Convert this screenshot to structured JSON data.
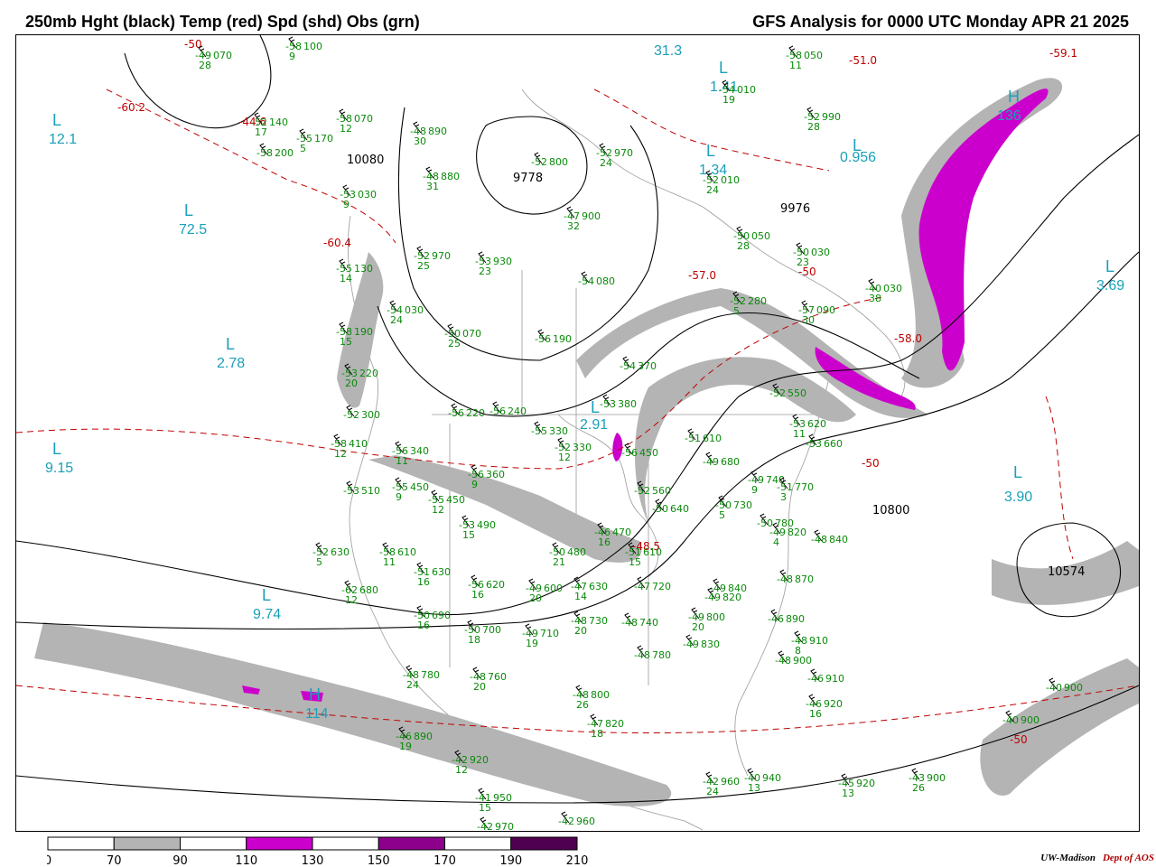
{
  "header": {
    "left_title": "250mb Hght (black) Temp (red) Spd (shd) Obs (grn)",
    "right_title": "GFS Analysis for 0000 UTC Monday  APR 21 2025"
  },
  "colors": {
    "height_contour": "#000000",
    "temperature_contour": "#c00000",
    "observations": "#0a8a0a",
    "extrema_labels": "#1aa0b8",
    "speed_70_90": "#b4b4b4",
    "speed_110_130": "#cc00cc",
    "speed_150_170": "#8c008c",
    "speed_190_210": "#500050"
  },
  "legend": {
    "ticks": [
      "0",
      "70",
      "90",
      "110",
      "130",
      "150",
      "170",
      "190",
      "210"
    ],
    "segments": [
      {
        "fill": "#ffffff"
      },
      {
        "fill": "#b4b4b4"
      },
      {
        "fill": "#ffffff"
      },
      {
        "fill": "#cc00cc"
      },
      {
        "fill": "#ffffff"
      },
      {
        "fill": "#8c008c"
      },
      {
        "fill": "#ffffff"
      },
      {
        "fill": "#500050"
      }
    ]
  },
  "extrema": [
    {
      "sym": "L",
      "value": "12.1"
    },
    {
      "sym": "L",
      "value": "72.5"
    },
    {
      "sym": "L",
      "value": "2.78"
    },
    {
      "sym": "L",
      "value": "9.15"
    },
    {
      "sym": "L",
      "value": "9.74"
    },
    {
      "sym": "L",
      "value": "31.3"
    },
    {
      "sym": "L",
      "value": "1.41"
    },
    {
      "sym": "L",
      "value": "1.34"
    },
    {
      "sym": "L",
      "value": "0.956"
    },
    {
      "sym": "L",
      "value": "3.69"
    },
    {
      "sym": "L",
      "value": "3.90"
    },
    {
      "sym": "L",
      "value": "2.91"
    },
    {
      "sym": "H",
      "value": "114"
    },
    {
      "sym": "H",
      "value": "136"
    }
  ],
  "height_labels": [
    "10080",
    "9778",
    "9976",
    "10800",
    "10574"
  ],
  "temperature_labels": [
    "-50",
    "-60.2",
    "-44.6",
    "-60.4",
    "-57.0",
    "-59.1",
    "-51.0",
    "-58.0",
    "-48.5",
    "-50",
    "-50",
    "-50"
  ],
  "observations": [
    {
      "t": "-49",
      "h": "070",
      "s": "28"
    },
    {
      "t": "-58",
      "h": "100",
      "s": "9"
    },
    {
      "t": "-52",
      "h": "140",
      "s": "17"
    },
    {
      "t": "-55",
      "h": "170",
      "s": "5"
    },
    {
      "t": "-58",
      "h": "200",
      "s": ""
    },
    {
      "t": "-58",
      "h": "070",
      "s": "12"
    },
    {
      "t": "-48",
      "h": "890",
      "s": "30"
    },
    {
      "t": "-48",
      "h": "880",
      "s": "31"
    },
    {
      "t": "-52",
      "h": "800",
      "s": ""
    },
    {
      "t": "-52",
      "h": "970",
      "s": "24"
    },
    {
      "t": "-54",
      "h": "010",
      "s": "19"
    },
    {
      "t": "-58",
      "h": "050",
      "s": "11"
    },
    {
      "t": "-52",
      "h": "990",
      "s": "28"
    },
    {
      "t": "-52",
      "h": "010",
      "s": "24"
    },
    {
      "t": "-47",
      "h": "900",
      "s": "32"
    },
    {
      "t": "-53",
      "h": "030",
      "s": "9"
    },
    {
      "t": "-52",
      "h": "970",
      "s": "25"
    },
    {
      "t": "-53",
      "h": "930",
      "s": "23"
    },
    {
      "t": "-55",
      "h": "130",
      "s": "14"
    },
    {
      "t": "-54",
      "h": "030",
      "s": "24"
    },
    {
      "t": "-50",
      "h": "070",
      "s": "25"
    },
    {
      "t": "-54",
      "h": "080",
      "s": ""
    },
    {
      "t": "-50",
      "h": "050",
      "s": "28"
    },
    {
      "t": "-50",
      "h": "030",
      "s": "23"
    },
    {
      "t": "-40",
      "h": "030",
      "s": "38"
    },
    {
      "t": "-56",
      "h": "190",
      "s": ""
    },
    {
      "t": "-53",
      "h": "220",
      "s": "20"
    },
    {
      "t": "-58",
      "h": "190",
      "s": "15"
    },
    {
      "t": "-54",
      "h": "370",
      "s": ""
    },
    {
      "t": "-52",
      "h": "280",
      "s": "5"
    },
    {
      "t": "-57",
      "h": "090",
      "s": "30"
    },
    {
      "t": "-52",
      "h": "300",
      "s": ""
    },
    {
      "t": "-56",
      "h": "220",
      "s": ""
    },
    {
      "t": "-56",
      "h": "240",
      "s": ""
    },
    {
      "t": "-53",
      "h": "380",
      "s": ""
    },
    {
      "t": "-52",
      "h": "550",
      "s": ""
    },
    {
      "t": "-53",
      "h": "620",
      "s": "11"
    },
    {
      "t": "-58",
      "h": "410",
      "s": "12"
    },
    {
      "t": "-56",
      "h": "340",
      "s": "11"
    },
    {
      "t": "-55",
      "h": "330",
      "s": ""
    },
    {
      "t": "-52",
      "h": "330",
      "s": "12"
    },
    {
      "t": "-56",
      "h": "450",
      "s": ""
    },
    {
      "t": "-51",
      "h": "610",
      "s": ""
    },
    {
      "t": "-49",
      "h": "680",
      "s": ""
    },
    {
      "t": "-53",
      "h": "660",
      "s": ""
    },
    {
      "t": "-56",
      "h": "360",
      "s": "9"
    },
    {
      "t": "-53",
      "h": "510",
      "s": ""
    },
    {
      "t": "-55",
      "h": "450",
      "s": "9"
    },
    {
      "t": "-52",
      "h": "560",
      "s": ""
    },
    {
      "t": "-50",
      "h": "640",
      "s": ""
    },
    {
      "t": "-49",
      "h": "740",
      "s": "9"
    },
    {
      "t": "-51",
      "h": "770",
      "s": "3"
    },
    {
      "t": "-55",
      "h": "450",
      "s": "12"
    },
    {
      "t": "-50",
      "h": "730",
      "s": "5"
    },
    {
      "t": "-50",
      "h": "780",
      "s": ""
    },
    {
      "t": "-53",
      "h": "490",
      "s": "15"
    },
    {
      "t": "-46",
      "h": "470",
      "s": "16"
    },
    {
      "t": "-49",
      "h": "820",
      "s": "4"
    },
    {
      "t": "-48",
      "h": "840",
      "s": ""
    },
    {
      "t": "-52",
      "h": "630",
      "s": "5"
    },
    {
      "t": "-58",
      "h": "610",
      "s": "11"
    },
    {
      "t": "-50",
      "h": "480",
      "s": "21"
    },
    {
      "t": "-51",
      "h": "610",
      "s": "15"
    },
    {
      "t": "-51",
      "h": "630",
      "s": "16"
    },
    {
      "t": "-56",
      "h": "620",
      "s": "16"
    },
    {
      "t": "-49",
      "h": "600",
      "s": "20"
    },
    {
      "t": "-47",
      "h": "630",
      "s": "14"
    },
    {
      "t": "-47",
      "h": "720",
      "s": ""
    },
    {
      "t": "-48",
      "h": "870",
      "s": ""
    },
    {
      "t": "-62",
      "h": "680",
      "s": "12"
    },
    {
      "t": "-49",
      "h": "840",
      "s": ""
    },
    {
      "t": "-49",
      "h": "820",
      "s": ""
    },
    {
      "t": "-50",
      "h": "690",
      "s": "16"
    },
    {
      "t": "-50",
      "h": "700",
      "s": "18"
    },
    {
      "t": "-49",
      "h": "710",
      "s": "19"
    },
    {
      "t": "-48",
      "h": "730",
      "s": "20"
    },
    {
      "t": "-48",
      "h": "740",
      "s": ""
    },
    {
      "t": "-49",
      "h": "800",
      "s": "20"
    },
    {
      "t": "-46",
      "h": "890",
      "s": ""
    },
    {
      "t": "-48",
      "h": "780",
      "s": ""
    },
    {
      "t": "-49",
      "h": "830",
      "s": ""
    },
    {
      "t": "-48",
      "h": "910",
      "s": "8"
    },
    {
      "t": "-48",
      "h": "900",
      "s": ""
    },
    {
      "t": "-48",
      "h": "780",
      "s": "24"
    },
    {
      "t": "-48",
      "h": "760",
      "s": "20"
    },
    {
      "t": "-46",
      "h": "910",
      "s": ""
    },
    {
      "t": "-48",
      "h": "800",
      "s": "26"
    },
    {
      "t": "-46",
      "h": "920",
      "s": "16"
    },
    {
      "t": "-47",
      "h": "820",
      "s": "18"
    },
    {
      "t": "-46",
      "h": "890",
      "s": "19"
    },
    {
      "t": "-42",
      "h": "920",
      "s": "12"
    },
    {
      "t": "-41",
      "h": "950",
      "s": "15"
    },
    {
      "t": "-42",
      "h": "970",
      "s": ""
    },
    {
      "t": "-42",
      "h": "960",
      "s": ""
    },
    {
      "t": "-42",
      "h": "960",
      "s": "24"
    },
    {
      "t": "-40",
      "h": "940",
      "s": "13"
    },
    {
      "t": "-45",
      "h": "920",
      "s": "13"
    },
    {
      "t": "-43",
      "h": "900",
      "s": "26"
    },
    {
      "t": "-40",
      "h": "900",
      "s": ""
    },
    {
      "t": "-40",
      "h": "900",
      "s": ""
    }
  ],
  "credit": {
    "org": "UW-Madison",
    "dept": "Dept of AOS"
  }
}
